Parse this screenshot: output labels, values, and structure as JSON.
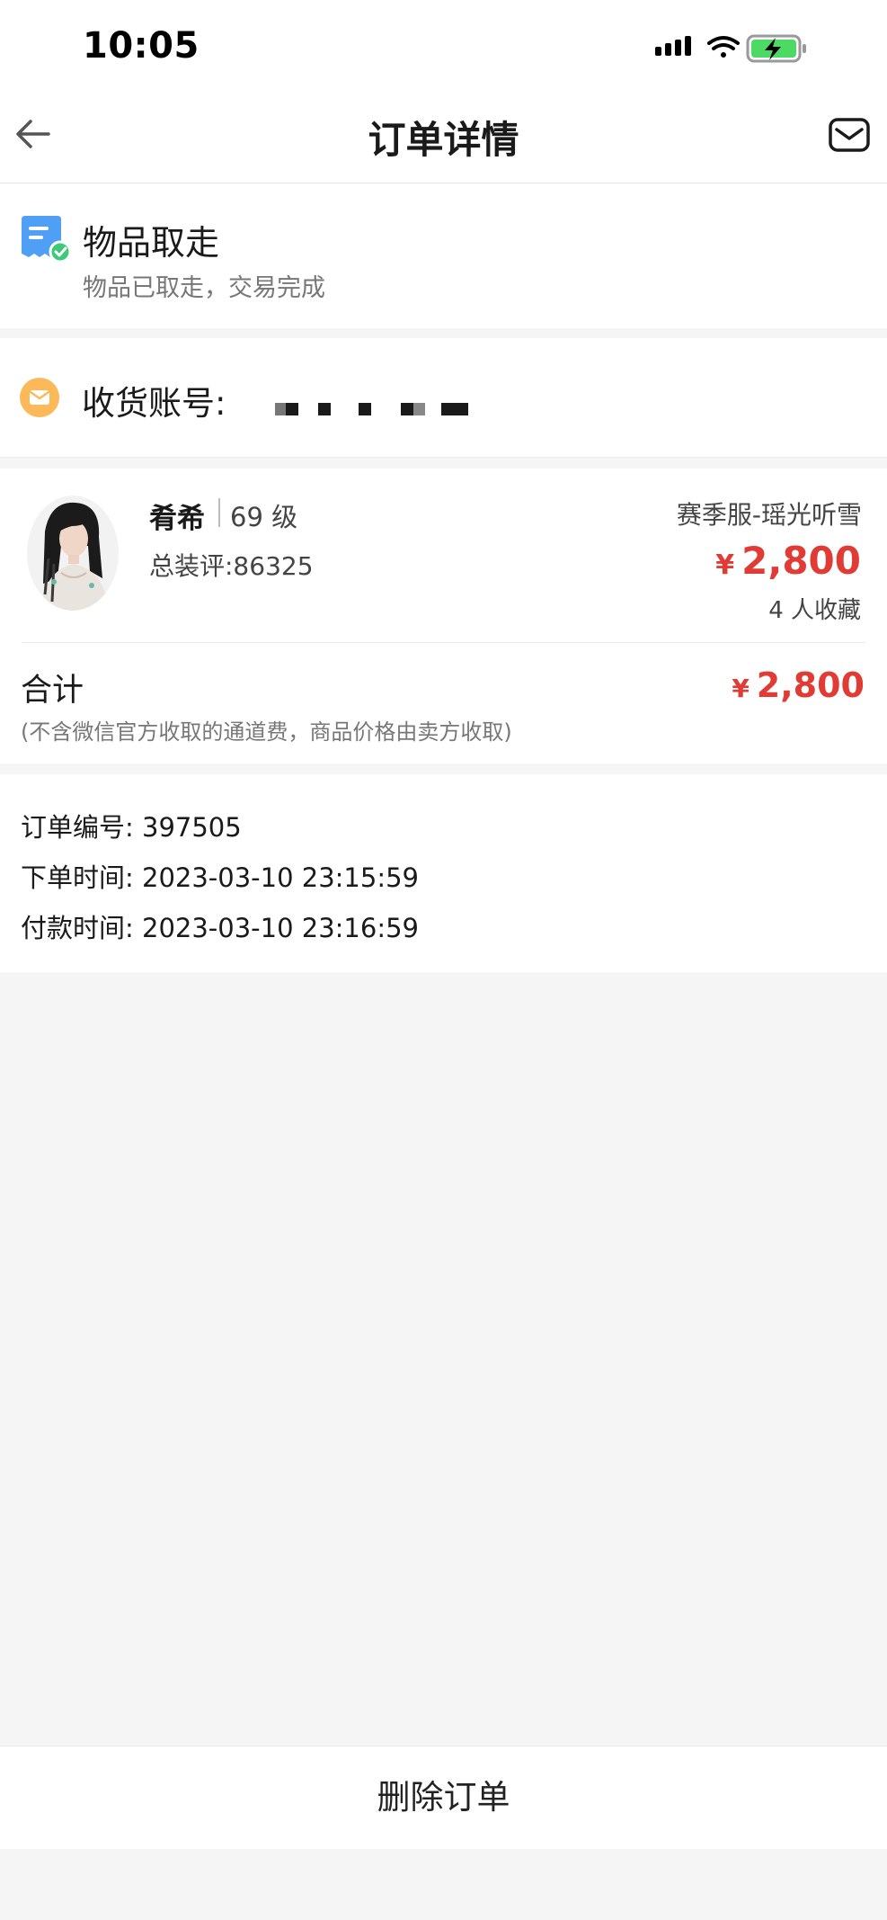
{
  "status_bar": {
    "time": "10:05"
  },
  "nav": {
    "title": "订单详情"
  },
  "order_status": {
    "title": "物品取走",
    "subtitle": "物品已取走，交易完成"
  },
  "account": {
    "label": "收货账号:"
  },
  "item": {
    "name": "肴希",
    "level": "69 级",
    "score": "总装评:86325",
    "server": "赛季服-瑶光听雪",
    "currency": "¥",
    "price": "2,800",
    "favorites": "4 人收藏"
  },
  "total": {
    "label": "合计",
    "currency": "¥",
    "price": "2,800",
    "note": "(不含微信官方收取的通道费，商品价格由卖方收取)"
  },
  "info": {
    "order_no": "订单编号: 397505",
    "order_time": "下单时间: 2023-03-10 23:15:59",
    "pay_time": "付款时间: 2023-03-10 23:16:59"
  },
  "footer": {
    "delete_label": "删除订单"
  },
  "colors": {
    "price": "#e03c35",
    "success": "#3ec87a",
    "doc_blue": "#4f9ff5",
    "mail_orange": "#fbb95a"
  }
}
